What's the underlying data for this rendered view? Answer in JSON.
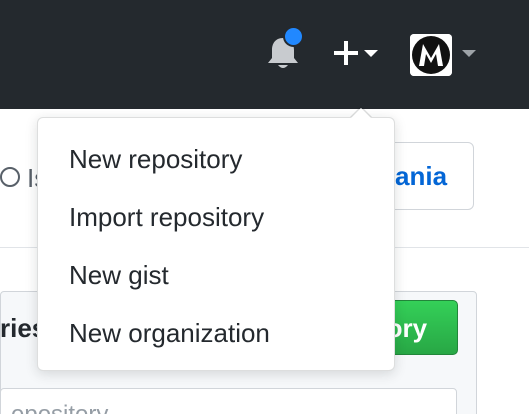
{
  "header": {
    "notifications": {
      "icon": "bell-icon",
      "has_unread": true,
      "dot_color": "#2188ff"
    },
    "create_menu": {
      "icon": "plus-icon",
      "caret_icon": "caret-down-icon"
    },
    "profile_menu": {
      "avatar_icon": "avatar-m-logo",
      "caret_icon": "caret-down-icon"
    },
    "background_color": "#24292e"
  },
  "dropdown": {
    "items": [
      {
        "label": "New repository"
      },
      {
        "label": "Import repository"
      },
      {
        "label": "New gist"
      },
      {
        "label": "New organization"
      }
    ]
  },
  "background": {
    "issues_tab_partial": "Is",
    "org_button_partial": "ania",
    "panel_heading_partial": "ries",
    "new_repo_button_partial": "tory",
    "repo_filter_placeholder_partial": "epository"
  },
  "colors": {
    "header_bg": "#24292e",
    "link_blue": "#0366d6",
    "primary_green": "#28a745",
    "text": "#24292e",
    "muted": "#586069"
  }
}
